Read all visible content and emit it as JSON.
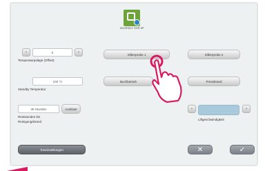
{
  "header": {
    "device_name": "SGURSKIY SGR 5P"
  },
  "temperature_offset": {
    "value": "0",
    "label": "Temperaturpalage (Offset)"
  },
  "standby": {
    "value": "100 °C",
    "label": "Standby Temperatur"
  },
  "restcount": {
    "value": "35 Stunden",
    "reset_label": "Auslöser",
    "label_line1": "Reststunden bis",
    "label_line2": "Reinigungsbrand"
  },
  "buttons": {
    "silverprobe1": "Silberprobe 1",
    "silverprobe2": "Silberprobe 2",
    "buchbetrieb": "Buchbetrieb",
    "pressbrand": "Pressbrand",
    "toneinstellungen": "Toneinstellungen"
  },
  "lift": {
    "label": "Liftgeschwindigkeit"
  },
  "icons": {
    "minus": "‹",
    "plus": "›",
    "cancel": "✕",
    "confirm": "✓"
  },
  "colors": {
    "accent": "#d81b60",
    "lift_slider": "#a9c9dc",
    "logo_green": "#6ea33a"
  }
}
